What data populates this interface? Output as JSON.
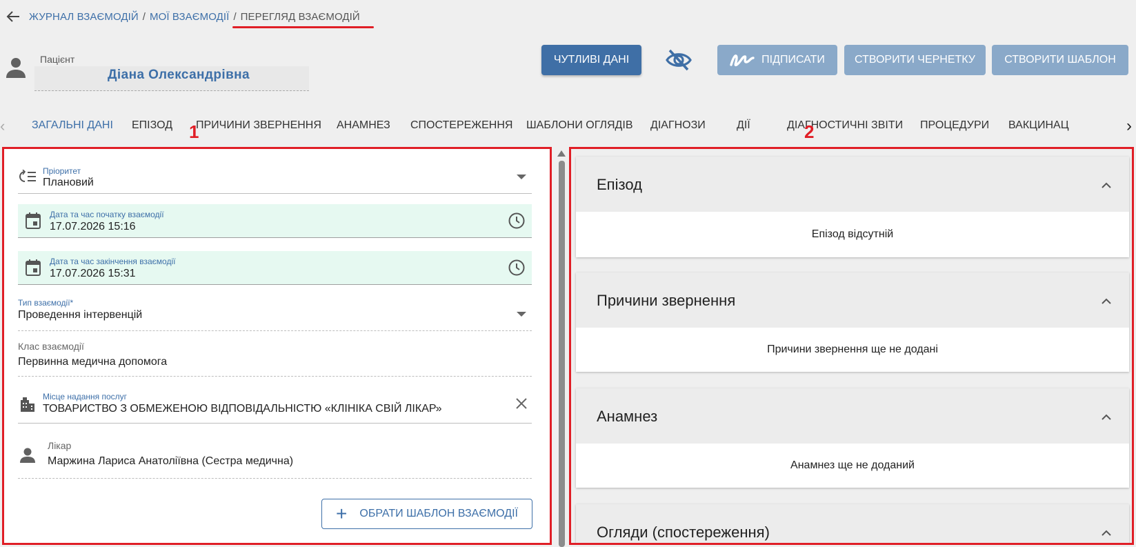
{
  "breadcrumb": {
    "items": [
      "ЖУРНАЛ ВЗАЄМОДІЙ",
      "МОЇ ВЗАЄМОДІЇ",
      "ПЕРЕГЛЯД ВЗАЄМОДІЙ"
    ],
    "separator": "/"
  },
  "patient": {
    "label": "Пацієнт",
    "name": "Діана Олександрівна"
  },
  "actions": {
    "sensitive": "ЧУТЛИВІ ДАНІ",
    "sign": "ПІДПИСАТИ",
    "draft": "СТВОРИТИ ЧЕРНЕТКУ",
    "template": "СТВОРИТИ ШАБЛОН"
  },
  "tabs": [
    {
      "label": "ЗАГАЛЬНІ ДАНІ",
      "active": true
    },
    {
      "label": "ЕПІЗОД"
    },
    {
      "label": "ПРИЧИНИ ЗВЕРНЕННЯ"
    },
    {
      "label": "АНАМНЕЗ"
    },
    {
      "label": "СПОСТЕРЕЖЕННЯ"
    },
    {
      "label": "ШАБЛОНИ ОГЛЯДІВ"
    },
    {
      "label": "ДІАГНОЗИ"
    },
    {
      "label": "ДІЇ"
    },
    {
      "label": "ДІАГНОСТИЧНІ ЗВІТИ"
    },
    {
      "label": "ПРОЦЕДУРИ"
    },
    {
      "label": "ВАКЦИНАЦ"
    }
  ],
  "markers": {
    "one": "1",
    "two": "2"
  },
  "form": {
    "priority": {
      "label": "Пріоритет",
      "value": "Плановий"
    },
    "start": {
      "label": "Дата та час початку взаємодії",
      "value": "17.07.2026 15:16"
    },
    "end": {
      "label": "Дата та час закінчення взаємодії",
      "value": "17.07.2026 15:31"
    },
    "type": {
      "label": "Тип взаємодії*",
      "value": "Проведення інтервенцій"
    },
    "class": {
      "label": "Клас взаємодії",
      "value": "Первинна медична допомога"
    },
    "place": {
      "label": "Місце надання послуг",
      "value": "ТОВАРИСТВО З ОБМЕЖЕНОЮ ВІДПОВІДАЛЬНІСТЮ «КЛІНІКА СВІЙ ЛІКАР»"
    },
    "doctor": {
      "label": "Лікар",
      "value": "Маржина Лариса Анатоліївна (Сестра медична)"
    },
    "choose_template": "ОБРАТИ ШАБЛОН ВЗАЄМОДІЇ"
  },
  "cards": [
    {
      "title": "Епізод",
      "body": "Епізод відсутній"
    },
    {
      "title": "Причини звернення",
      "body": "Причини звернення ще не додані"
    },
    {
      "title": "Анамнез",
      "body": "Анамнез ще не доданий"
    },
    {
      "title": "Огляди (спостереження)",
      "body": ""
    }
  ],
  "colors": {
    "accent": "#3d6fa8",
    "button_primary": "#3f6fa6",
    "button_disabled": "#8aa9c9",
    "highlight_red": "#e01e26",
    "date_field_bg": "#e6f9f1"
  }
}
